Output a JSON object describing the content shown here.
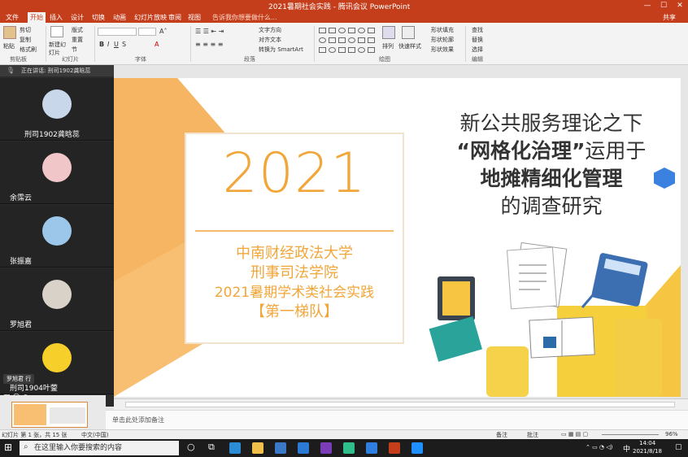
{
  "window": {
    "title": "2021暑期社会实践 - 腾讯会议 PowerPoint",
    "share_label": "共享"
  },
  "tabs": [
    {
      "label": "文件",
      "active": false
    },
    {
      "label": "开始",
      "active": true
    },
    {
      "label": "插入",
      "active": false
    },
    {
      "label": "设计",
      "active": false
    },
    {
      "label": "切换",
      "active": false
    },
    {
      "label": "动画",
      "active": false
    },
    {
      "label": "幻灯片放映",
      "active": false
    },
    {
      "label": "审阅",
      "active": false
    },
    {
      "label": "视图",
      "active": false
    }
  ],
  "tell_me": "告诉我你想要做什么...",
  "ribbon": {
    "clipboard": {
      "paste": "粘贴",
      "cut": "剪切",
      "copy": "复制",
      "format_painter": "格式刷",
      "group": "剪贴板"
    },
    "slides": {
      "new_slide": "新建幻灯片",
      "layout": "版式",
      "reset": "重置",
      "section": "节",
      "group": "幻灯片"
    },
    "font": {
      "group": "字体"
    },
    "paragraph": {
      "text_direction": "文字方向",
      "align_text": "对齐文本",
      "smartart": "转换为 SmartArt",
      "group": "段落"
    },
    "drawing": {
      "arrange": "排列",
      "quick_styles": "快速样式",
      "shape_fill": "形状填充",
      "shape_outline": "形状轮廓",
      "shape_effects": "形状效果",
      "group": "绘图"
    },
    "editing": {
      "find": "查找",
      "replace": "替换",
      "select": "选择",
      "group": "编辑"
    }
  },
  "meeting": {
    "speaking": "正在讲话: 刑司1902龚晗蕊",
    "participants": [
      {
        "name": "刑司1902龚晗蕊"
      },
      {
        "name": "余霈云"
      },
      {
        "name": "张振嘉"
      },
      {
        "name": "罗旭君"
      },
      {
        "name": "刑司1904叶蓥"
      }
    ],
    "tooltip": "罗旭君 行"
  },
  "slide": {
    "year": "2021",
    "lines": [
      "中南财经政法大学",
      "刑事司法学院",
      "2021暑期学术类社会实践",
      "【第一梯队】"
    ],
    "title_line1": "新公共服务理论之下",
    "title_line2_bold": "“网格化治理”",
    "title_line2_rest": "运用于",
    "title_line3": "地摊精细化管理",
    "title_line4": "的调查研究"
  },
  "notes_placeholder": "单击此处添加备注",
  "status": {
    "slide_info": "幻灯片 第 1 张，共 15 张",
    "language": "中文(中国)",
    "notes": "备注",
    "comments": "批注",
    "zoom": "96%"
  },
  "taskbar": {
    "search_placeholder": "在这里输入你要搜索的内容",
    "time": "14:04",
    "date": "2021/8/18",
    "ime": "中"
  },
  "colors": {
    "accent": "#c43e1c",
    "slide_orange": "#f1a63a"
  }
}
